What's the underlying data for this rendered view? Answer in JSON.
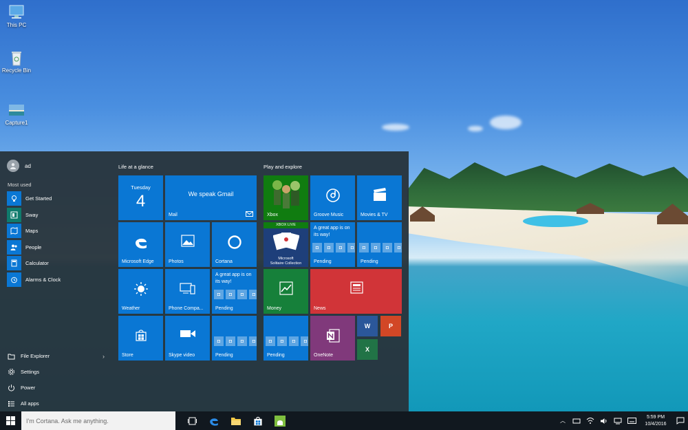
{
  "desktop": {
    "icons": [
      {
        "label": "This PC",
        "icon": "computer-icon"
      },
      {
        "label": "Recycle Bin",
        "icon": "recycle-bin-icon"
      },
      {
        "label": "Capture1",
        "icon": "image-file-icon"
      }
    ]
  },
  "start": {
    "user": "ad",
    "most_used_title": "Most used",
    "most_used": [
      {
        "label": "Get Started",
        "icon": "lightbulb-icon"
      },
      {
        "label": "Sway",
        "icon": "sway-icon"
      },
      {
        "label": "Maps",
        "icon": "maps-icon"
      },
      {
        "label": "People",
        "icon": "people-icon"
      },
      {
        "label": "Calculator",
        "icon": "calculator-icon"
      },
      {
        "label": "Alarms & Clock",
        "icon": "alarm-icon"
      }
    ],
    "bottom": [
      {
        "label": "File Explorer",
        "icon": "folder-icon"
      },
      {
        "label": "Settings",
        "icon": "gear-icon"
      },
      {
        "label": "Power",
        "icon": "power-icon"
      },
      {
        "label": "All apps",
        "icon": "list-icon"
      }
    ],
    "groups": [
      {
        "title": "Life at a glance"
      },
      {
        "title": "Play and explore"
      }
    ],
    "tiles": {
      "calendar": {
        "day": "Tuesday",
        "date": "4"
      },
      "mail": {
        "label": "Mail",
        "headline": "We speak Gmail"
      },
      "edge": {
        "label": "Microsoft Edge"
      },
      "photos": {
        "label": "Photos"
      },
      "cortana": {
        "label": "Cortana"
      },
      "weather": {
        "label": "Weather"
      },
      "phone": {
        "label": "Phone Compa..."
      },
      "pending1": {
        "msg": "A great app is on its way!",
        "label": "Pending"
      },
      "store": {
        "label": "Store"
      },
      "skype": {
        "label": "Skype video"
      },
      "pending2": {
        "label": "Pending"
      },
      "xbox": {
        "label": "Xbox"
      },
      "groove": {
        "label": "Groove Music"
      },
      "movies": {
        "label": "Movies & TV"
      },
      "solitaire": {
        "badge": "XBOX LIVE",
        "line1": "Microsoft",
        "line2": "Solitaire Collection"
      },
      "pending3": {
        "msg": "A great app is on its way!",
        "label": "Pending"
      },
      "pending4": {
        "label": "Pending"
      },
      "money": {
        "label": "Money"
      },
      "news": {
        "label": "News"
      },
      "pending5": {
        "label": "Pending"
      },
      "onenote": {
        "label": "OneNote"
      },
      "word": {
        "letter": "W"
      },
      "powerpoint": {
        "letter": "P"
      },
      "excel": {
        "letter": "X"
      }
    },
    "colors": {
      "tile_blue": "#0a77d4",
      "xbox_green": "#107c10",
      "money_green": "#16803a",
      "news_red": "#d13438",
      "onenote_purple": "#80397b",
      "word_blue": "#2b579a",
      "ppt_orange": "#d24726",
      "excel_green": "#217346"
    }
  },
  "taskbar": {
    "search_placeholder": "I'm Cortana. Ask me anything.",
    "apps": [
      "task-view-icon",
      "edge-icon",
      "file-explorer-icon",
      "store-icon",
      "android-icon"
    ],
    "time": "5:59 PM",
    "date": "10/4/2016"
  }
}
